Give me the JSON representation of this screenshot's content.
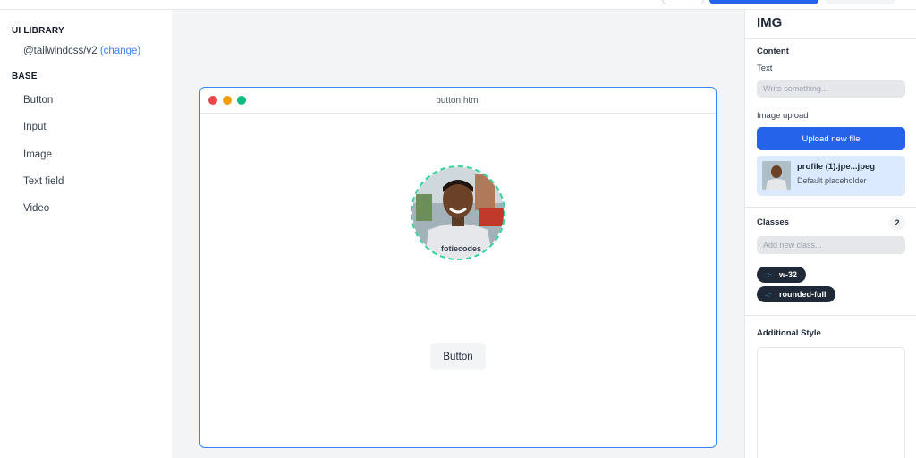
{
  "sidebar": {
    "ui_library_title": "UI LIBRARY",
    "library_name": "@tailwindcss/v2",
    "change_link": "(change)",
    "base_title": "BASE",
    "items": [
      {
        "label": "Button"
      },
      {
        "label": "Input"
      },
      {
        "label": "Image"
      },
      {
        "label": "Text field"
      },
      {
        "label": "Video"
      }
    ]
  },
  "canvas": {
    "browser_title": "button.html",
    "preview_button_label": "Button",
    "avatar_shirt_text": "fotiecodes"
  },
  "panel": {
    "title": "IMG",
    "content_title": "Content",
    "text_label": "Text",
    "text_placeholder": "Write something...",
    "image_upload_label": "Image upload",
    "upload_button": "Upload new file",
    "file": {
      "name": "profile (1).jpe...jpeg",
      "subtitle": "Default placeholder"
    },
    "classes_title": "Classes",
    "classes_count": "2",
    "class_placeholder": "Add new class...",
    "classes": [
      {
        "label": "w-32"
      },
      {
        "label": "rounded-full"
      }
    ],
    "additional_style_title": "Additional Style"
  },
  "colors": {
    "accent": "#2563eb",
    "selection_border": "#3b82f6",
    "dashed_outline": "#34d399",
    "chip_bg": "#1f2937",
    "tailwind_teal": "#38bdf8"
  }
}
